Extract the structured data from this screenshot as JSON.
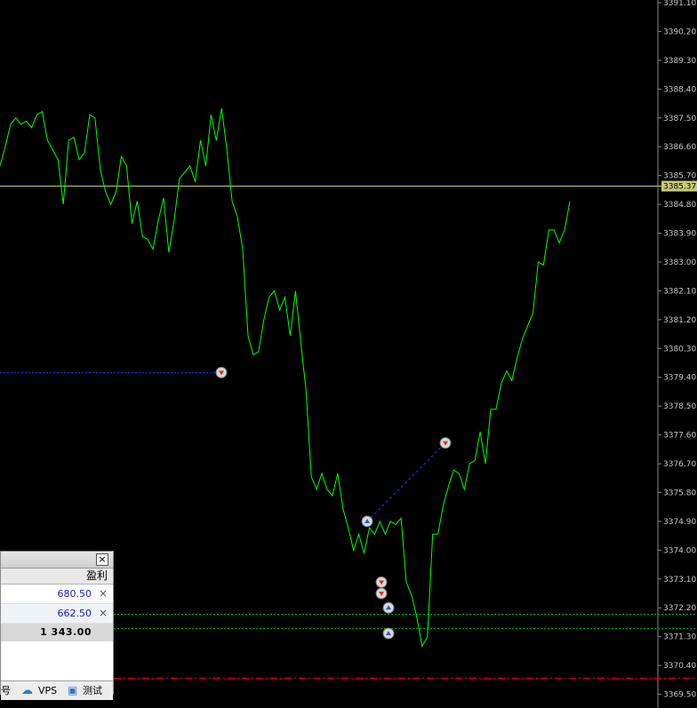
{
  "chart": {
    "yticks": [
      "3391.10",
      "3390.20",
      "3389.30",
      "3388.40",
      "3387.50",
      "3386.60",
      "3385.70",
      "3384.80",
      "3383.90",
      "3383.00",
      "3382.10",
      "3381.20",
      "3380.30",
      "3379.40",
      "3378.50",
      "3377.60",
      "3376.70",
      "3375.80",
      "3374.90",
      "3374.00",
      "3373.10",
      "3372.20",
      "3371.30",
      "3370.40",
      "3369.50"
    ],
    "current_price": "3385.37",
    "colors": {
      "background": "#000000",
      "price_line": "#00ff00",
      "bid_line": "#c8c87a",
      "axis_text": "#c8c8c8",
      "sl_line": "#00c000",
      "red_line": "#ff0000",
      "trade_link": "#2040ff"
    }
  },
  "chart_data": {
    "type": "line",
    "symbol_price_axis": "right",
    "ylim": [
      3369.5,
      3391.1
    ],
    "series": [
      {
        "values": [
          3386.0,
          3386.6,
          3387.3,
          3387.5,
          3387.3,
          3387.4,
          3387.2,
          3387.6,
          3387.7,
          3386.8,
          3386.5,
          3386.2,
          3384.8,
          3386.8,
          3386.9,
          3386.2,
          3386.4,
          3387.6,
          3387.5,
          3385.9,
          3385.2,
          3384.8,
          3385.2,
          3386.3,
          3386.0,
          3384.2,
          3384.9,
          3383.8,
          3383.7,
          3383.4,
          3384.3,
          3385.0,
          3383.3,
          3384.3,
          3385.6,
          3385.8,
          3386.0,
          3385.5,
          3386.8,
          3386.0,
          3387.6,
          3386.8,
          3387.8,
          3386.5,
          3384.9,
          3384.4,
          3383.4,
          3380.7,
          3380.1,
          3380.2,
          3381.2,
          3381.9,
          3382.1,
          3381.5,
          3381.9,
          3380.7,
          3382.1,
          3380.5,
          3379.0,
          3376.3,
          3375.9,
          3376.4,
          3375.9,
          3375.7,
          3376.4,
          3375.3,
          3374.7,
          3374.0,
          3374.5,
          3373.9,
          3374.7,
          3374.5,
          3374.9,
          3374.5,
          3374.9,
          3374.8,
          3375.0,
          3373.0,
          3372.6,
          3371.9,
          3371.0,
          3371.3,
          3374.5,
          3374.5,
          3375.4,
          3376.0,
          3376.5,
          3376.4,
          3375.9,
          3376.7,
          3376.8,
          3377.7,
          3376.7,
          3378.4,
          3378.4,
          3379.2,
          3379.6,
          3379.3,
          3380.0,
          3380.6,
          3381.0,
          3381.4,
          3383.0,
          3382.9,
          3384.0,
          3384.0,
          3383.6,
          3384.0,
          3384.9
        ],
        "color": "#00ff00"
      }
    ],
    "horizontal_lines": [
      {
        "kind": "bid",
        "price": 3385.37
      },
      {
        "kind": "stop_dotted_green",
        "price": 3372.0
      },
      {
        "kind": "stop_dotted_green",
        "price": 3371.55
      },
      {
        "kind": "dash_dot_red",
        "price": 3370.0
      }
    ],
    "trade_markers": [
      {
        "side": "sell",
        "price": 3379.55
      },
      {
        "side": "buy",
        "price": 3374.9
      },
      {
        "side": "sell",
        "price": 3377.35
      },
      {
        "side": "sell",
        "price": 3373.0
      },
      {
        "side": "sell",
        "price": 3372.65
      },
      {
        "side": "buy",
        "price": 3372.2
      },
      {
        "side": "buy",
        "price": 3371.4
      }
    ]
  },
  "terminal": {
    "header_label": "盈利",
    "rows": [
      {
        "profit": "680.50",
        "close_glyph": "×"
      },
      {
        "profit": "662.50",
        "close_glyph": "×"
      }
    ],
    "total": "1 343.00",
    "close_glyph": "×",
    "tabs": {
      "fragment": "号",
      "vps_label": "VPS",
      "test_label": "测试",
      "cloud_icon": "☁",
      "chip_icon": "▣"
    }
  }
}
